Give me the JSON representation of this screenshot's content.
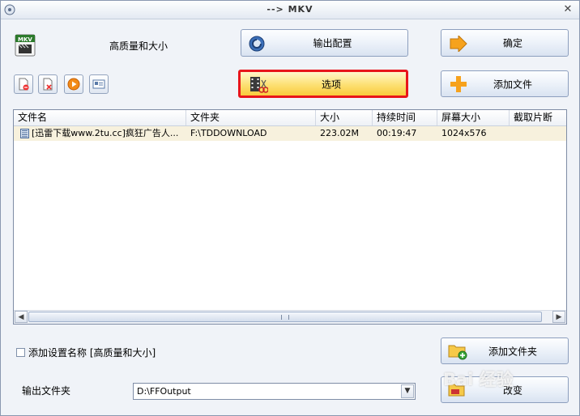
{
  "window": {
    "title": "--> MKV"
  },
  "preset": {
    "name": "高质量和大小"
  },
  "buttons": {
    "output_config": "输出配置",
    "confirm": "确定",
    "options": "选项",
    "add_file": "添加文件",
    "add_folder": "添加文件夹",
    "change": "改变"
  },
  "file_list": {
    "columns": [
      "文件名",
      "文件夹",
      "大小",
      "持续时间",
      "屏幕大小",
      "截取片断"
    ],
    "rows": [
      {
        "name": "[迅雷下载www.2tu.cc]疯狂广告人...",
        "folder": "F:\\TDDOWNLOAD",
        "size": "223.02M",
        "duration": "00:19:47",
        "screen": "1024x576",
        "clip": ""
      }
    ]
  },
  "settings": {
    "add_setting_name_label": "添加设置名称 [高质量和大小]",
    "add_setting_name_checked": false,
    "output_folder_label": "输出文件夹",
    "output_folder_value": "D:\\FFOutput"
  },
  "watermark": {
    "text": "Bai 经验"
  },
  "colors": {
    "highlight_border": "#e8151b",
    "row_bg": "#f7f1dd",
    "accent": "#f6a21d"
  }
}
